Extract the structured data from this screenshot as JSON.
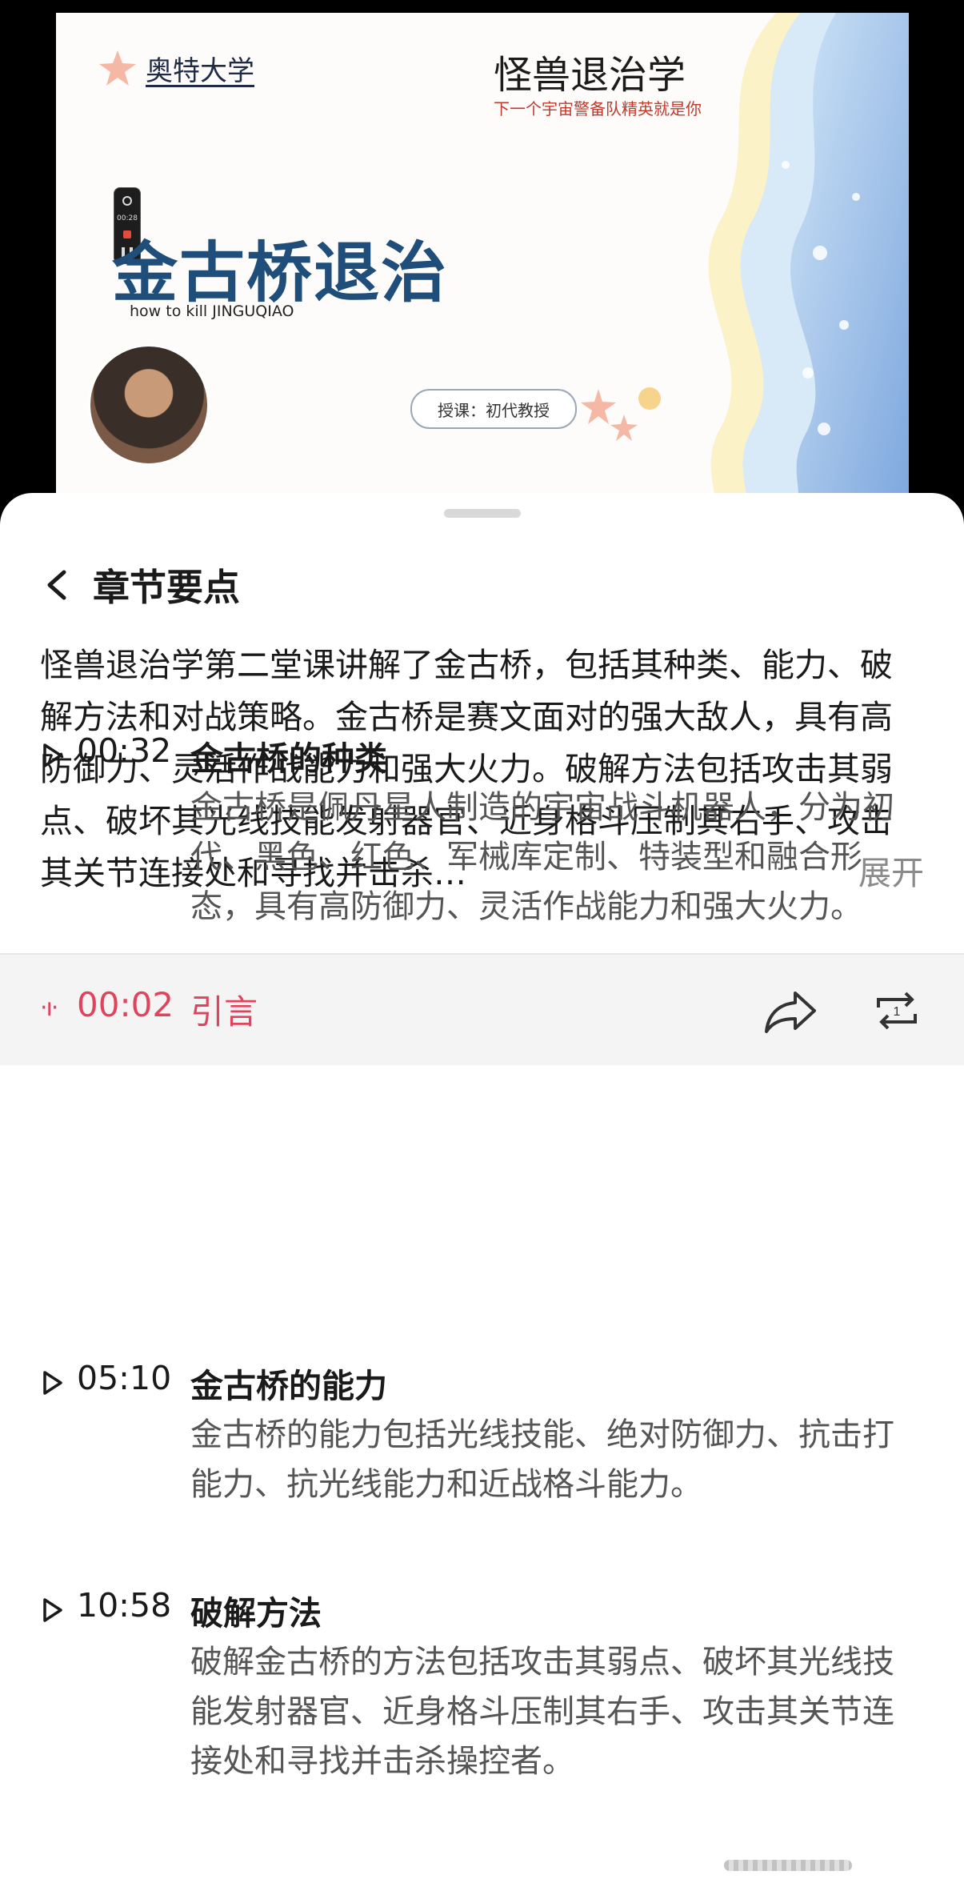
{
  "video": {
    "university": "奥特大学",
    "course_title": "怪兽退治学",
    "course_subtitle": "下一个宇宙警备队精英就是你",
    "slide_title": "金古桥退治",
    "slide_subtitle": "how to kill JINGUQIAO",
    "teacher_label": "授课：初代教授",
    "recording": {
      "time": "00:28"
    },
    "icons": [
      "starfish-icon",
      "search-icon",
      "record-icon",
      "pause-icon"
    ]
  },
  "sheet": {
    "header_title": "章节要点",
    "summary": "怪兽退治学第二堂课讲解了金古桥，包括其种类、能力、破解方法和对战策略。金古桥是赛文面对的强大敌人，具有高防御力、灵活作战能力和强大火力。破解方法包括攻击其弱点、破坏其光线技能发射器官、近身格斗压制其右手、攻击其关节连接处和寻找并击杀…",
    "expand_label": "展开",
    "active_chapter": {
      "time": "00:02",
      "title": "引言"
    },
    "chapters": [
      {
        "time": "00:32",
        "title": "金古桥的种类",
        "desc": "金古桥是佩丹星人制造的宇宙战斗机器人，分为初代、黑色、红色、军械库定制、特装型和融合形态，具有高防御力、灵活作战能力和强大火力。"
      },
      {
        "time": "05:10",
        "title": "金古桥的能力",
        "desc": "金古桥的能力包括光线技能、绝对防御力、抗击打能力、抗光线能力和近战格斗能力。"
      },
      {
        "time": "10:58",
        "title": "破解方法",
        "desc": "破解金古桥的方法包括攻击其弱点、破坏其光线技能发射器官、近身格斗压制其右手、攻击其关节连接处和寻找并击杀操控者。"
      }
    ]
  },
  "colors": {
    "accent": "#e0435c",
    "title_blue": "#1f4e7a",
    "active_bg": "#f4f4f5"
  }
}
